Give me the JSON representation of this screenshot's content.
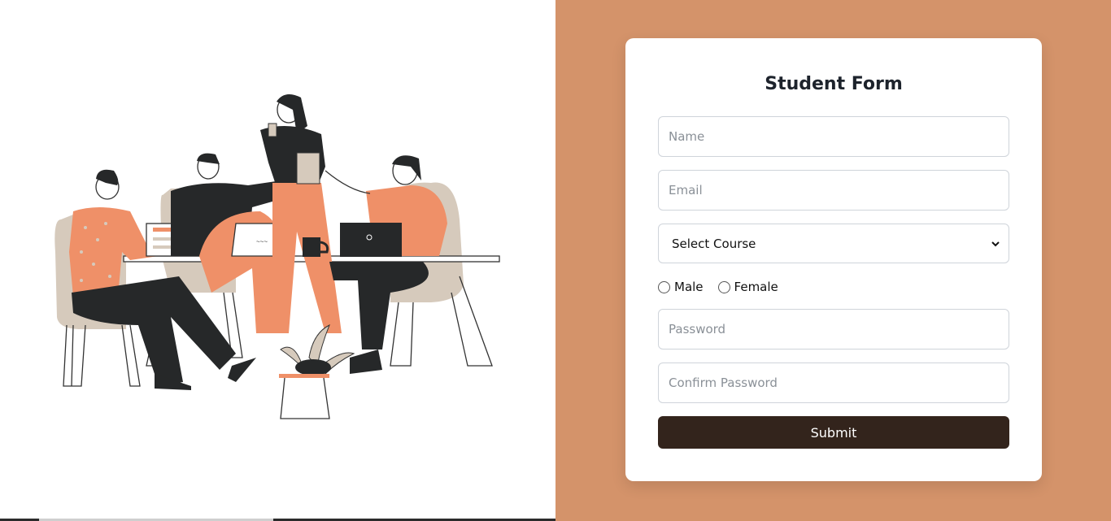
{
  "colors": {
    "accent": "#d4936a",
    "button_bg": "#33241c",
    "orange": "#ef9068",
    "dark": "#262829",
    "beige": "#d6cabc"
  },
  "form": {
    "title": "Student Form",
    "name_placeholder": "Name",
    "email_placeholder": "Email",
    "course_select": {
      "selected": "Select Course",
      "icon": "chevron-down-icon"
    },
    "gender_options": [
      "Male",
      "Female"
    ],
    "password_placeholder": "Password",
    "confirm_password_placeholder": "Confirm Password",
    "submit_label": "Submit"
  },
  "illustration": {
    "icon": "team-meeting-illustration"
  }
}
